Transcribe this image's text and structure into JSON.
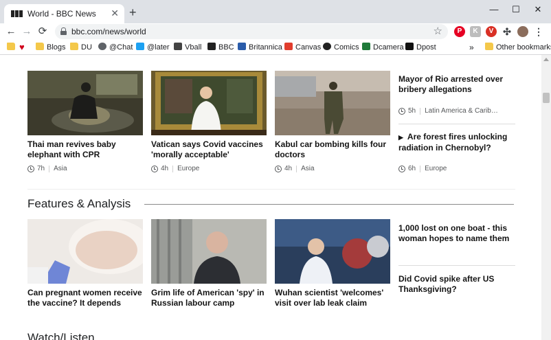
{
  "browser": {
    "tab_title": "World - BBC News",
    "tab_close": "✕",
    "new_tab": "+",
    "url": "bbc.com/news/world",
    "win_minimize": "—",
    "win_maximize": "☐",
    "win_close": "✕",
    "bookmarks": [
      "Blogs",
      "DU",
      "@Chat",
      "@later",
      "Vball",
      "BBC",
      "Britannica",
      "Canvas",
      "Comics",
      "Dcamera",
      "Dpost"
    ],
    "overflow": "»",
    "other_bookmarks": "Other bookmarks"
  },
  "top_stories": [
    {
      "title": "Thai man revives baby elephant with CPR",
      "time": "7h",
      "region": "Asia"
    },
    {
      "title": "Vatican says Covid vaccines 'morally acceptable'",
      "time": "4h",
      "region": "Europe"
    },
    {
      "title": "Kabul car bombing kills four doctors",
      "time": "4h",
      "region": "Asia"
    }
  ],
  "side_stories": [
    {
      "title": "Mayor of Rio arrested over bribery allegations",
      "time": "5h",
      "region": "Latin America & Carib…"
    },
    {
      "title": "Are forest fires unlocking radiation in Chernobyl?",
      "time": "6h",
      "region": "Europe",
      "play_icon": "▶"
    }
  ],
  "features": {
    "heading": "Features & Analysis",
    "cards": [
      {
        "title": "Can pregnant women receive the vaccine? It depends"
      },
      {
        "title": "Grim life of American 'spy' in Russian labour camp"
      },
      {
        "title": "Wuhan scientist 'welcomes' visit over lab leak claim"
      }
    ],
    "side": [
      {
        "title": "1,000 lost on one boat - this woman hopes to name them"
      },
      {
        "title": "Did Covid spike after US Thanksgiving?"
      }
    ]
  },
  "next_section": "Watch/Listen"
}
